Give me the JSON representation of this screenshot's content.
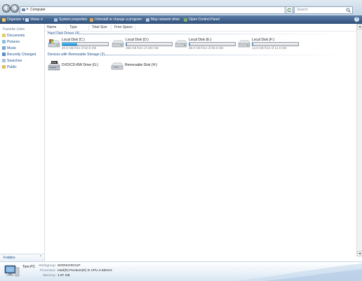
{
  "address": {
    "location": "Computer",
    "search_placeholder": "Search"
  },
  "toolbar": {
    "organize": "Organize",
    "views": "Views",
    "system_properties": "System properties",
    "uninstall": "Uninstall or change a program",
    "map_drive": "Map network drive",
    "control_panel": "Open Control Panel",
    "help": "?"
  },
  "sidebar": {
    "heading": "Favorite Links",
    "items": [
      {
        "label": "Documents",
        "icon": "documents-icon"
      },
      {
        "label": "Pictures",
        "icon": "pictures-icon"
      },
      {
        "label": "Music",
        "icon": "music-icon"
      },
      {
        "label": "Recently Changed",
        "icon": "recently-changed-icon"
      },
      {
        "label": "Searches",
        "icon": "searches-icon"
      },
      {
        "label": "Public",
        "icon": "public-icon"
      }
    ],
    "folders_label": "Folders",
    "folders_chevron": "^"
  },
  "columns": {
    "name": "Name",
    "type": "Type",
    "total_size": "Total Size",
    "free_space": "Free Space"
  },
  "groups": {
    "hard_disks": "Hard Disk Drives (4)",
    "removable": "Devices with Removable Storage (2)"
  },
  "drives": [
    {
      "name": "Local Disk (C:)",
      "info": "40.5 GB free of 60.8 GB",
      "used_fraction": 0.33,
      "icon": "windows-drive-icon"
    },
    {
      "name": "Local Disk (D:)",
      "info": "396 GB free of 400 GB",
      "used_fraction": 0.01,
      "icon": "hard-drive-icon"
    },
    {
      "name": "Local Disk (E:)",
      "info": "99.8 GB free of 99.9 GB",
      "used_fraction": 0.005,
      "icon": "hard-drive-icon"
    },
    {
      "name": "Local Disk (F:)",
      "info": "14.9 GB free of 14.9 GB",
      "used_fraction": 0.005,
      "icon": "hard-drive-icon"
    }
  ],
  "removable": [
    {
      "name": "DVD/CD-RW Drive (G:)",
      "icon": "dvd-drive-icon"
    },
    {
      "name": "Removable Disk (H:)",
      "icon": "removable-disk-icon"
    }
  ],
  "details": {
    "pc_name": "Tom-PC",
    "workgroup_label": "Workgroup:",
    "workgroup": "WORKGROUP",
    "processor_label": "Processor:",
    "processor": "Intel(R) Pentium(R) D  CPU 2.66GHz",
    "memory_label": "Memory:",
    "memory": "1.87 GB"
  },
  "colors": {
    "toolbar": "#3a5b86",
    "link": "#1a4f8f",
    "bar_fill": "#1b8bd6"
  }
}
